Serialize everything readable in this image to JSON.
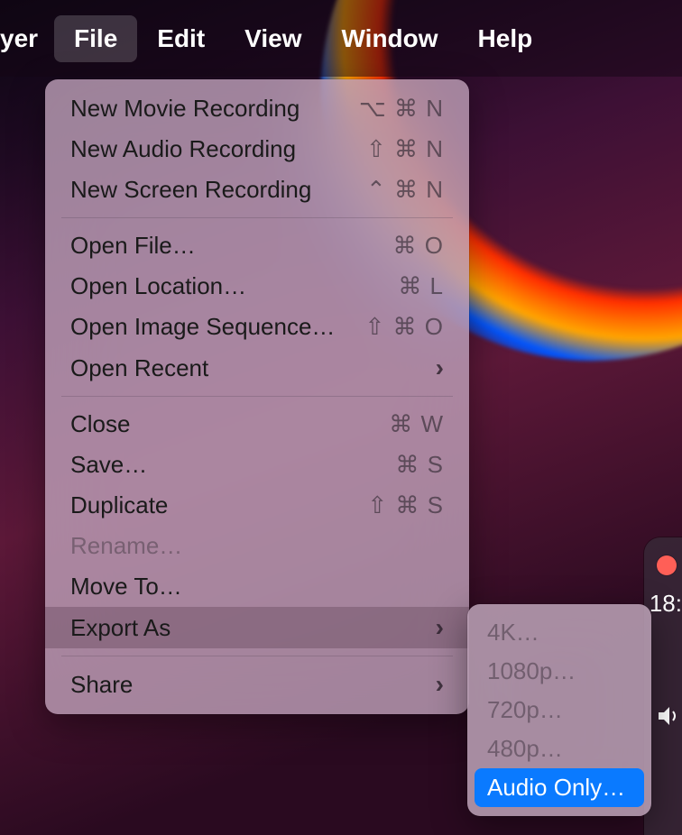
{
  "menubar": {
    "app_partial": "yer",
    "items": [
      "File",
      "Edit",
      "View",
      "Window",
      "Help"
    ],
    "active_index": 0
  },
  "file_menu": {
    "sections": [
      [
        {
          "label": "New Movie Recording",
          "shortcut": "⌥ ⌘ N"
        },
        {
          "label": "New Audio Recording",
          "shortcut": "⇧ ⌘ N"
        },
        {
          "label": "New Screen Recording",
          "shortcut": "⌃ ⌘ N"
        }
      ],
      [
        {
          "label": "Open File…",
          "shortcut": "⌘ O"
        },
        {
          "label": "Open Location…",
          "shortcut": "⌘ L"
        },
        {
          "label": "Open Image Sequence…",
          "shortcut": "⇧ ⌘ O"
        },
        {
          "label": "Open Recent",
          "submenu": true
        }
      ],
      [
        {
          "label": "Close",
          "shortcut": "⌘ W"
        },
        {
          "label": "Save…",
          "shortcut": "⌘ S"
        },
        {
          "label": "Duplicate",
          "shortcut": "⇧ ⌘ S"
        },
        {
          "label": "Rename…",
          "disabled": true
        },
        {
          "label": "Move To…"
        },
        {
          "label": "Export As",
          "submenu": true,
          "highlighted": true
        }
      ],
      [
        {
          "label": "Share",
          "submenu": true
        }
      ]
    ]
  },
  "export_submenu": {
    "items": [
      {
        "label": "4K…",
        "disabled": true
      },
      {
        "label": "1080p…",
        "disabled": true
      },
      {
        "label": "720p…",
        "disabled": true
      },
      {
        "label": "480p…",
        "disabled": true
      },
      {
        "label": "Audio Only…",
        "selected": true
      }
    ]
  },
  "window_peek": {
    "time": "18:"
  }
}
